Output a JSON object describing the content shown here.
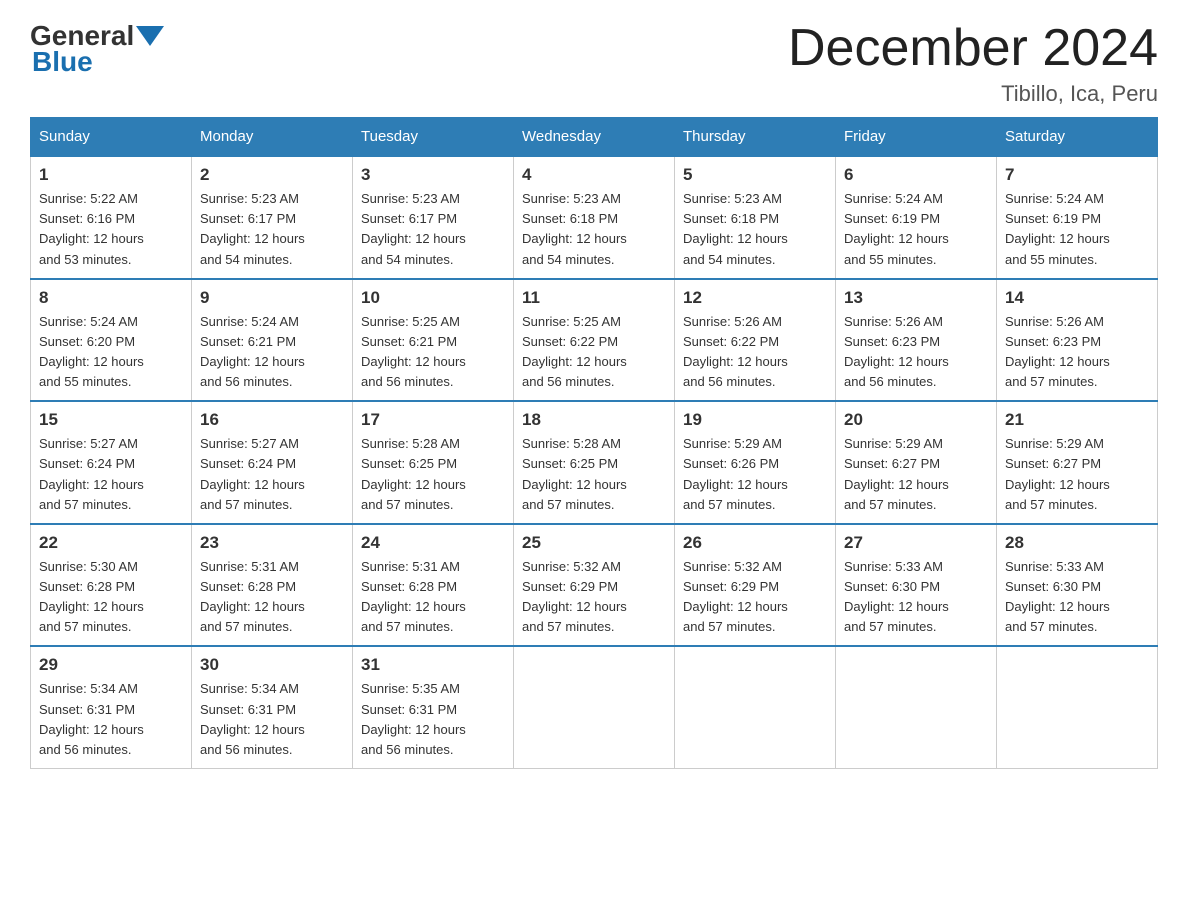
{
  "header": {
    "title": "December 2024",
    "subtitle": "Tibillo, Ica, Peru",
    "logo_general": "General",
    "logo_blue": "Blue"
  },
  "weekdays": [
    "Sunday",
    "Monday",
    "Tuesday",
    "Wednesday",
    "Thursday",
    "Friday",
    "Saturday"
  ],
  "weeks": [
    [
      {
        "day": "1",
        "sunrise": "5:22 AM",
        "sunset": "6:16 PM",
        "daylight": "12 hours and 53 minutes."
      },
      {
        "day": "2",
        "sunrise": "5:23 AM",
        "sunset": "6:17 PM",
        "daylight": "12 hours and 54 minutes."
      },
      {
        "day": "3",
        "sunrise": "5:23 AM",
        "sunset": "6:17 PM",
        "daylight": "12 hours and 54 minutes."
      },
      {
        "day": "4",
        "sunrise": "5:23 AM",
        "sunset": "6:18 PM",
        "daylight": "12 hours and 54 minutes."
      },
      {
        "day": "5",
        "sunrise": "5:23 AM",
        "sunset": "6:18 PM",
        "daylight": "12 hours and 54 minutes."
      },
      {
        "day": "6",
        "sunrise": "5:24 AM",
        "sunset": "6:19 PM",
        "daylight": "12 hours and 55 minutes."
      },
      {
        "day": "7",
        "sunrise": "5:24 AM",
        "sunset": "6:19 PM",
        "daylight": "12 hours and 55 minutes."
      }
    ],
    [
      {
        "day": "8",
        "sunrise": "5:24 AM",
        "sunset": "6:20 PM",
        "daylight": "12 hours and 55 minutes."
      },
      {
        "day": "9",
        "sunrise": "5:24 AM",
        "sunset": "6:21 PM",
        "daylight": "12 hours and 56 minutes."
      },
      {
        "day": "10",
        "sunrise": "5:25 AM",
        "sunset": "6:21 PM",
        "daylight": "12 hours and 56 minutes."
      },
      {
        "day": "11",
        "sunrise": "5:25 AM",
        "sunset": "6:22 PM",
        "daylight": "12 hours and 56 minutes."
      },
      {
        "day": "12",
        "sunrise": "5:26 AM",
        "sunset": "6:22 PM",
        "daylight": "12 hours and 56 minutes."
      },
      {
        "day": "13",
        "sunrise": "5:26 AM",
        "sunset": "6:23 PM",
        "daylight": "12 hours and 56 minutes."
      },
      {
        "day": "14",
        "sunrise": "5:26 AM",
        "sunset": "6:23 PM",
        "daylight": "12 hours and 57 minutes."
      }
    ],
    [
      {
        "day": "15",
        "sunrise": "5:27 AM",
        "sunset": "6:24 PM",
        "daylight": "12 hours and 57 minutes."
      },
      {
        "day": "16",
        "sunrise": "5:27 AM",
        "sunset": "6:24 PM",
        "daylight": "12 hours and 57 minutes."
      },
      {
        "day": "17",
        "sunrise": "5:28 AM",
        "sunset": "6:25 PM",
        "daylight": "12 hours and 57 minutes."
      },
      {
        "day": "18",
        "sunrise": "5:28 AM",
        "sunset": "6:25 PM",
        "daylight": "12 hours and 57 minutes."
      },
      {
        "day": "19",
        "sunrise": "5:29 AM",
        "sunset": "6:26 PM",
        "daylight": "12 hours and 57 minutes."
      },
      {
        "day": "20",
        "sunrise": "5:29 AM",
        "sunset": "6:27 PM",
        "daylight": "12 hours and 57 minutes."
      },
      {
        "day": "21",
        "sunrise": "5:29 AM",
        "sunset": "6:27 PM",
        "daylight": "12 hours and 57 minutes."
      }
    ],
    [
      {
        "day": "22",
        "sunrise": "5:30 AM",
        "sunset": "6:28 PM",
        "daylight": "12 hours and 57 minutes."
      },
      {
        "day": "23",
        "sunrise": "5:31 AM",
        "sunset": "6:28 PM",
        "daylight": "12 hours and 57 minutes."
      },
      {
        "day": "24",
        "sunrise": "5:31 AM",
        "sunset": "6:28 PM",
        "daylight": "12 hours and 57 minutes."
      },
      {
        "day": "25",
        "sunrise": "5:32 AM",
        "sunset": "6:29 PM",
        "daylight": "12 hours and 57 minutes."
      },
      {
        "day": "26",
        "sunrise": "5:32 AM",
        "sunset": "6:29 PM",
        "daylight": "12 hours and 57 minutes."
      },
      {
        "day": "27",
        "sunrise": "5:33 AM",
        "sunset": "6:30 PM",
        "daylight": "12 hours and 57 minutes."
      },
      {
        "day": "28",
        "sunrise": "5:33 AM",
        "sunset": "6:30 PM",
        "daylight": "12 hours and 57 minutes."
      }
    ],
    [
      {
        "day": "29",
        "sunrise": "5:34 AM",
        "sunset": "6:31 PM",
        "daylight": "12 hours and 56 minutes."
      },
      {
        "day": "30",
        "sunrise": "5:34 AM",
        "sunset": "6:31 PM",
        "daylight": "12 hours and 56 minutes."
      },
      {
        "day": "31",
        "sunrise": "5:35 AM",
        "sunset": "6:31 PM",
        "daylight": "12 hours and 56 minutes."
      },
      null,
      null,
      null,
      null
    ]
  ],
  "labels": {
    "sunrise": "Sunrise:",
    "sunset": "Sunset:",
    "daylight": "Daylight:"
  }
}
